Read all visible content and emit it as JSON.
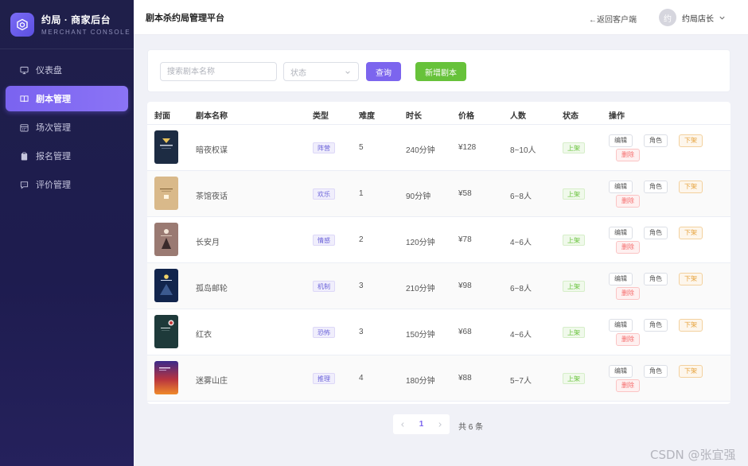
{
  "brand": {
    "title": "约局 · 商家后台",
    "subtitle": "MERCHANT CONSOLE"
  },
  "sidebar": {
    "items": [
      {
        "label": "仪表盘",
        "icon": "monitor-icon",
        "active": false
      },
      {
        "label": "剧本管理",
        "icon": "book-icon",
        "active": true
      },
      {
        "label": "场次管理",
        "icon": "calendar-icon",
        "active": false
      },
      {
        "label": "报名管理",
        "icon": "clipboard-icon",
        "active": false
      },
      {
        "label": "评价管理",
        "icon": "comment-icon",
        "active": false
      }
    ]
  },
  "header": {
    "title": "剧本杀约局管理平台",
    "back_link": "←返回客户端",
    "user": {
      "avatar_text": "约",
      "name": "约局店长"
    }
  },
  "toolbar": {
    "search_placeholder": "搜索剧本名称",
    "status_placeholder": "状态",
    "query_label": "查询",
    "add_label": "新增剧本"
  },
  "table": {
    "columns": [
      "封面",
      "剧本名称",
      "类型",
      "难度",
      "时长",
      "价格",
      "人数",
      "状态",
      "操作"
    ],
    "actions": {
      "edit": "编辑",
      "role": "角色",
      "offline": "下架",
      "delete": "删除"
    },
    "rows": [
      {
        "name": "暗夜权谋",
        "type": "阵营",
        "difficulty": "5",
        "duration": "240分钟",
        "price": "¥128",
        "players": "8~10人",
        "status": "上架",
        "cover": "cover-dark-throne"
      },
      {
        "name": "茶馆夜话",
        "type": "欢乐",
        "difficulty": "1",
        "duration": "90分钟",
        "price": "¥58",
        "players": "6~8人",
        "status": "上架",
        "cover": "cover-teahouse"
      },
      {
        "name": "长安月",
        "type": "情感",
        "difficulty": "2",
        "duration": "120分钟",
        "price": "¥78",
        "players": "4~6人",
        "status": "上架",
        "cover": "cover-changan-moon"
      },
      {
        "name": "孤岛邮轮",
        "type": "机制",
        "difficulty": "3",
        "duration": "210分钟",
        "price": "¥98",
        "players": "6~8人",
        "status": "上架",
        "cover": "cover-island-cruise"
      },
      {
        "name": "红衣",
        "type": "恐怖",
        "difficulty": "3",
        "duration": "150分钟",
        "price": "¥68",
        "players": "4~6人",
        "status": "上架",
        "cover": "cover-red-dress"
      },
      {
        "name": "迷雾山庄",
        "type": "推理",
        "difficulty": "4",
        "duration": "180分钟",
        "price": "¥88",
        "players": "5~7人",
        "status": "上架",
        "cover": "cover-misty-manor"
      }
    ]
  },
  "pagination": {
    "current": "1",
    "total_text": "共 6 条"
  },
  "watermark": "CSDN @张宜强",
  "colors": {
    "accent": "#7c65ee",
    "success": "#67c23a",
    "warning": "#e6a23c",
    "danger": "#f56c6c",
    "sidebar_bg": "#1f1f4a"
  }
}
